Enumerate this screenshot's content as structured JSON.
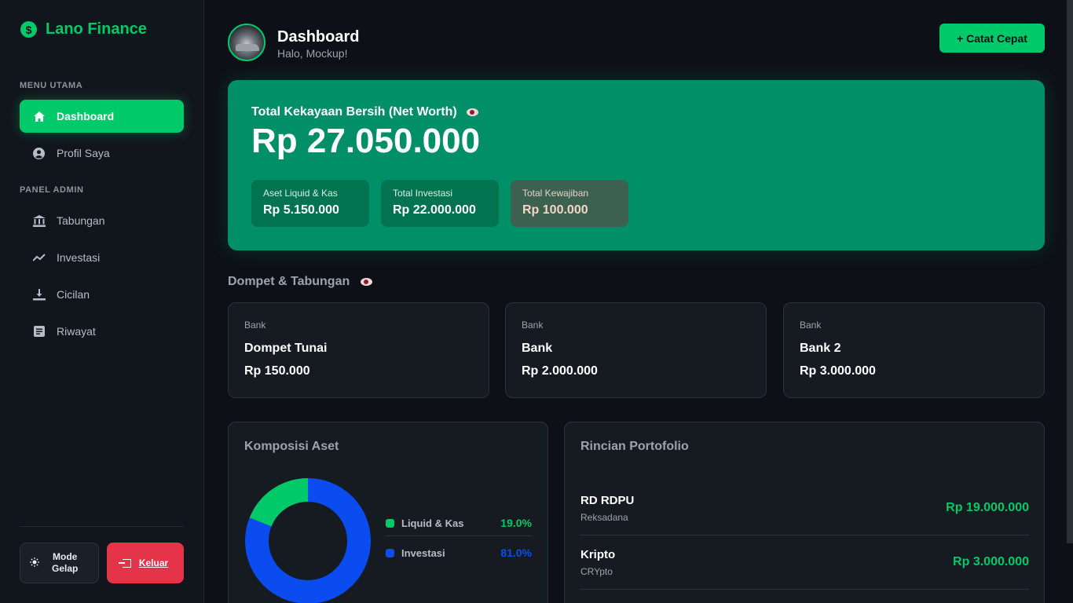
{
  "brand": {
    "name": "Lano Finance",
    "icon": "dollar-coin-icon"
  },
  "sidebar": {
    "menu_label": "MENU UTAMA",
    "menu_items": [
      {
        "label": "Dashboard",
        "icon": "home-icon",
        "active": true
      },
      {
        "label": "Profil Saya",
        "icon": "user-circle-icon",
        "active": false
      }
    ],
    "admin_label": "PANEL ADMIN",
    "admin_items": [
      {
        "label": "Tabungan",
        "icon": "bank-icon"
      },
      {
        "label": "Investasi",
        "icon": "trend-line-icon"
      },
      {
        "label": "Cicilan",
        "icon": "download-tray-icon"
      },
      {
        "label": "Riwayat",
        "icon": "document-icon"
      }
    ],
    "mode_label_1": "Mode",
    "mode_label_2": "Gelap",
    "logout_label": "Keluar"
  },
  "header": {
    "title": "Dashboard",
    "greeting": "Halo, Mockup!",
    "quick_action": "+ Catat Cepat"
  },
  "net_worth": {
    "label": "Total Kekayaan Bersih (Net Worth)",
    "value": "Rp 27.050.000",
    "stats": [
      {
        "label": "Aset Liquid & Kas",
        "value": "Rp 5.150.000"
      },
      {
        "label": "Total Investasi",
        "value": "Rp 22.000.000"
      },
      {
        "label": "Total Kewajiban",
        "value": "Rp 100.000"
      }
    ]
  },
  "wallets": {
    "title": "Dompet & Tabungan",
    "items": [
      {
        "type": "Bank",
        "name": "Dompet Tunai",
        "balance": "Rp 150.000"
      },
      {
        "type": "Bank",
        "name": "Bank",
        "balance": "Rp 2.000.000"
      },
      {
        "type": "Bank",
        "name": "Bank 2",
        "balance": "Rp 3.000.000"
      }
    ]
  },
  "composition": {
    "title": "Komposisi Aset",
    "segments": [
      {
        "label": "Liquid & Kas",
        "percent": "19.0%",
        "fraction": 0.19,
        "color": "#00c969"
      },
      {
        "label": "Investasi",
        "percent": "81.0%",
        "fraction": 0.81,
        "color": "#0a4cf0"
      }
    ]
  },
  "portfolio": {
    "title": "Rincian Portofolio",
    "items": [
      {
        "name": "RD RDPU",
        "type": "Reksadana",
        "value": "Rp 19.000.000"
      },
      {
        "name": "Kripto",
        "type": "CRYpto",
        "value": "Rp 3.000.000"
      }
    ]
  },
  "colors": {
    "accent": "#00c969",
    "card": "#008f66",
    "danger": "#e5344a"
  }
}
